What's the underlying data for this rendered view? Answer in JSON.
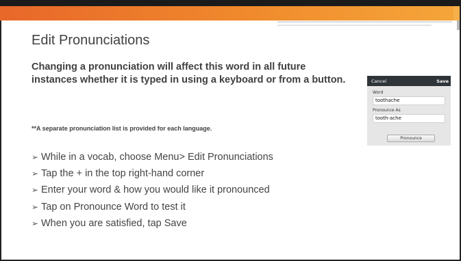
{
  "slide": {
    "title": "Edit Pronunciations",
    "intro": "Changing a pronunciation will affect this word in all future instances whether it is typed in using a keyboard or from a button.",
    "note": "**A separate pronunciation list is provided for each language.",
    "bullet_glyph": "➢",
    "steps": [
      "While in a vocab, choose Menu> Edit Pronunciations",
      "Tap the + in the top right-hand corner",
      "Enter your word & how you would like it pronounced",
      "Tap on Pronounce Word to test it",
      "When you are satisfied, tap Save"
    ]
  },
  "dialog": {
    "cancel_label": "Cancel",
    "save_label": "Save",
    "word_label": "Word",
    "word_value": "toothache",
    "pronounce_as_label": "Pronounce As",
    "pronounce_as_value": "tooth-ache",
    "pronounce_button_label": "Pronounce"
  },
  "colors": {
    "accent_orange": "#f08a2c",
    "top_band": "#1b1b1b",
    "text": "#404040",
    "dialog_header": "#2f3439"
  }
}
